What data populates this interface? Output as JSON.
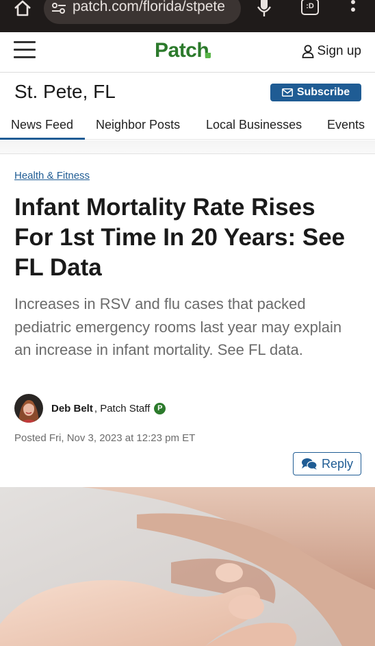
{
  "browser": {
    "url": "patch.com/florida/stpete"
  },
  "header": {
    "logo": "Patch",
    "signup_label": "Sign up"
  },
  "location": {
    "title": "St. Pete, FL",
    "subscribe_label": "Subscribe"
  },
  "nav": {
    "tabs": [
      {
        "label": "News Feed",
        "active": true
      },
      {
        "label": "Neighbor Posts",
        "active": false
      },
      {
        "label": "Local Businesses",
        "active": false
      },
      {
        "label": "Events",
        "active": false
      }
    ]
  },
  "article": {
    "category": "Health & Fitness",
    "headline": "Infant Mortality Rate Rises For 1st Time In 20 Years: See FL Data",
    "dek": "Increases in RSV and flu cases that packed pediatric emergency rooms last year may explain an increase in infant mortality. See FL data.",
    "author_name": "Deb Belt",
    "author_role": "Patch Staff",
    "badge": "P",
    "posted": "Posted Fri, Nov 3, 2023 at 12:23 pm ET",
    "reply_label": "Reply"
  },
  "colors": {
    "brand_green": "#2c7a2c",
    "link_blue": "#1f5c94",
    "browser_bg": "#1f1b1a"
  }
}
